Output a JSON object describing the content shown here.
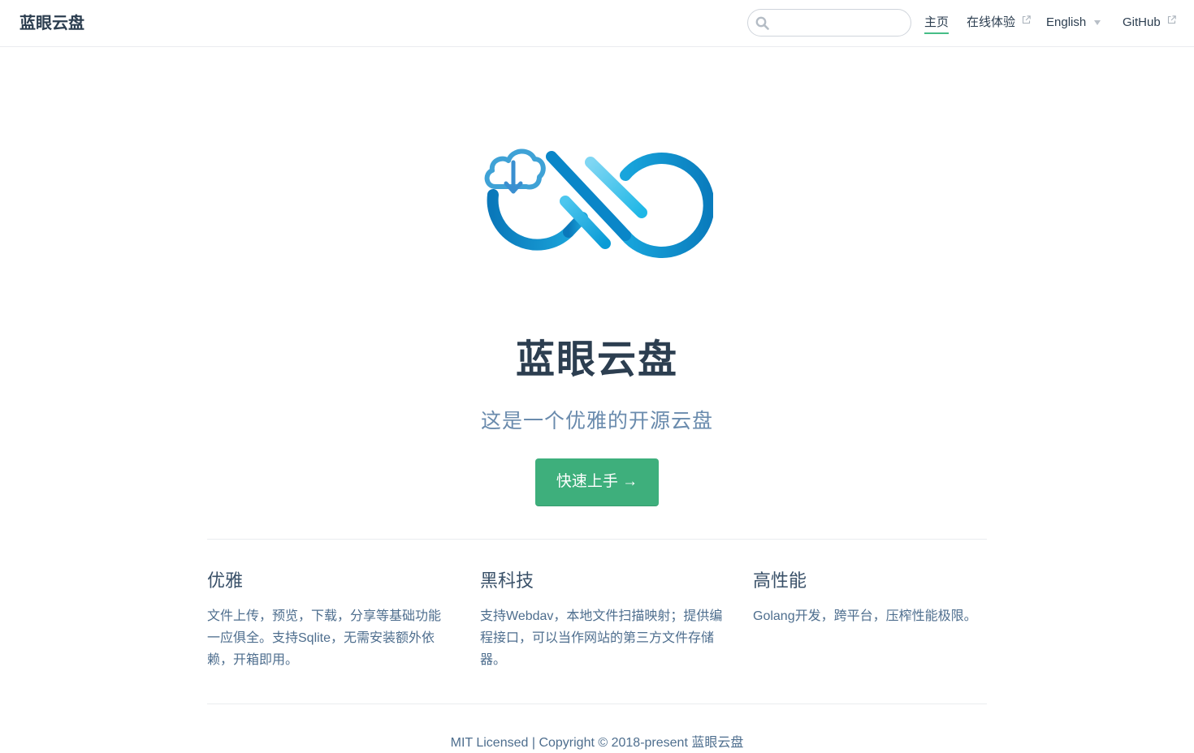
{
  "navbar": {
    "site_name": "蓝眼云盘",
    "search": {
      "placeholder": "",
      "value": ""
    },
    "links": [
      {
        "label": "主页",
        "active": true
      },
      {
        "label": "在线体验",
        "external": true
      },
      {
        "label": "English",
        "dropdown": true
      },
      {
        "label": "GitHub",
        "external": true
      }
    ]
  },
  "hero": {
    "title": "蓝眼云盘",
    "description": "这是一个优雅的开源云盘",
    "action_label": "快速上手 →"
  },
  "features": [
    {
      "title": "优雅",
      "details": "文件上传，预览，下载，分享等基础功能一应俱全。支持Sqlite，无需安装额外依赖，开箱即用。"
    },
    {
      "title": "黑科技",
      "details": "支持Webdav，本地文件扫描映射；提供编程接口，可以当作网站的第三方文件存储器。"
    },
    {
      "title": "高性能",
      "details": "Golang开发，跨平台，压榨性能极限。"
    }
  ],
  "footer": {
    "text": "MIT Licensed | Copyright © 2018-present 蓝眼云盘"
  },
  "colors": {
    "accent": "#3eaf7c",
    "text": "#2c3e50",
    "muted": "#6a8bad",
    "logo_dark_blue": "#0a7fc0",
    "logo_light_blue": "#2ec0ea"
  }
}
